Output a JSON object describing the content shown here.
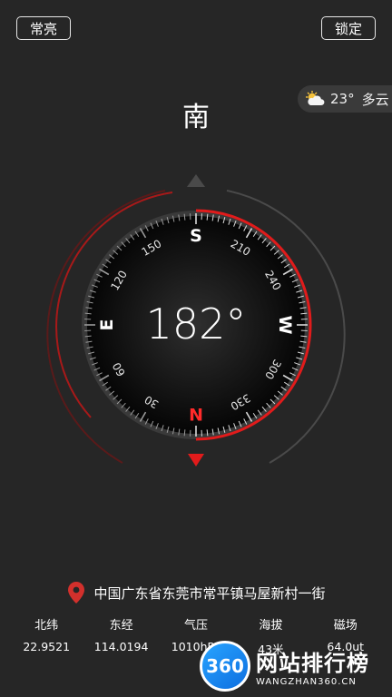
{
  "top_bar": {
    "left_button": "常亮",
    "right_button": "锁定"
  },
  "weather": {
    "icon": "partly-cloudy-icon",
    "temperature": "23°",
    "condition": "多云"
  },
  "direction": "南",
  "heading": "182°",
  "compass": {
    "cardinals": [
      {
        "label": "S",
        "angle": 0,
        "color": "#ffffff"
      },
      {
        "label": "W",
        "angle": 90,
        "color": "#ffffff"
      },
      {
        "label": "N",
        "angle": 180,
        "color": "#ff2a2a"
      },
      {
        "label": "E",
        "angle": 270,
        "color": "#ffffff"
      }
    ],
    "degree_labels": [
      {
        "label": "210",
        "angle": 30
      },
      {
        "label": "240",
        "angle": 60
      },
      {
        "label": "300",
        "angle": 120
      },
      {
        "label": "330",
        "angle": 150
      },
      {
        "label": "30",
        "angle": 210
      },
      {
        "label": "60",
        "angle": 240
      },
      {
        "label": "120",
        "angle": 300
      },
      {
        "label": "150",
        "angle": 330
      }
    ],
    "accent_color": "#e11b1b"
  },
  "location": {
    "icon": "location-pin-icon",
    "address": "中国广东省东莞市常平镇马屋新村一街"
  },
  "stats": [
    {
      "label": "北纬",
      "value": "22.9521"
    },
    {
      "label": "东经",
      "value": "114.0194"
    },
    {
      "label": "气压",
      "value": "1010hPa"
    },
    {
      "label": "海拔",
      "value": "43米"
    },
    {
      "label": "磁场",
      "value": "64.0ut"
    }
  ],
  "watermark": {
    "logo": "360",
    "title": "网站排行榜",
    "subtitle": "WANGZHAN360.CN"
  }
}
